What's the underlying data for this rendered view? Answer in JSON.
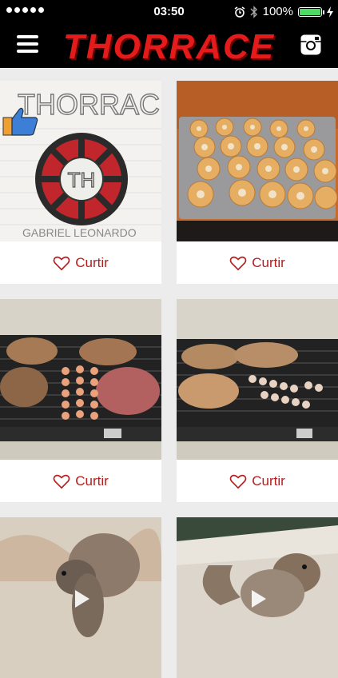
{
  "status_bar": {
    "time": "03:50",
    "battery_percent": "100%",
    "battery_level": 1.0,
    "icons": [
      "signal-dots-icon",
      "alarm-icon",
      "bluetooth-icon",
      "battery-icon",
      "charging-icon"
    ]
  },
  "header": {
    "logo_text": "THORRACE",
    "menu_icon": "hamburger-menu-icon",
    "right_icon": "instagram-icon",
    "accent_color": "#e41b1b"
  },
  "feed": {
    "like_label": "Curtir",
    "like_icon": "heart-outline-icon",
    "posts": [
      {
        "image": "thorrace-logo-drawing",
        "like_label": "Curtir"
      },
      {
        "image": "cinnamon-rolls-tray",
        "like_label": "Curtir"
      },
      {
        "image": "grill-steaks-shrimp-skewers",
        "like_label": "Curtir"
      },
      {
        "image": "grill-fish-shrimp-skewers",
        "like_label": "Curtir"
      },
      {
        "image": "squirrel-video",
        "like_label": ""
      },
      {
        "image": "squirrel-video",
        "like_label": ""
      }
    ]
  }
}
